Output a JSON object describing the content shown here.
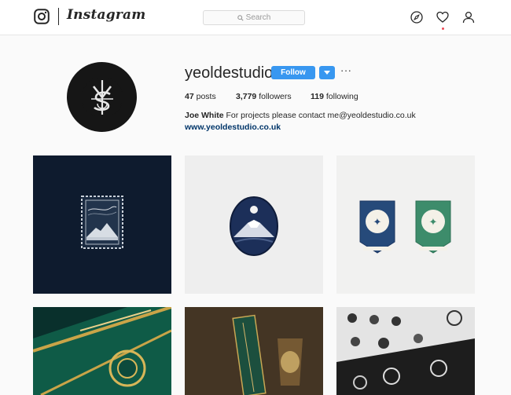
{
  "app": {
    "wordmark": "Instagram"
  },
  "search": {
    "placeholder": "Search"
  },
  "profile": {
    "username": "yeoldestudio",
    "follow_label": "Follow",
    "more_label": "···",
    "stats": {
      "posts_count": "47",
      "posts_label": "posts",
      "followers_count": "3,779",
      "followers_label": "followers",
      "following_count": "119",
      "following_label": "following"
    },
    "bio": {
      "name": "Joe White",
      "text": "For projects please contact me@yeoldestudio.co.uk"
    },
    "website": "www.yeoldestudio.co.uk"
  },
  "colors": {
    "accent": "#3897f0",
    "link": "#003569",
    "notification": "#ed4956"
  },
  "icons": [
    "instagram-logo-icon",
    "search-icon",
    "explore-compass-icon",
    "heart-icon",
    "profile-icon",
    "chevron-down-icon"
  ],
  "posts": [
    {
      "kind": "photo",
      "subject": "stamp"
    },
    {
      "kind": "photo",
      "subject": "mountain-badge"
    },
    {
      "kind": "photo",
      "subject": "labels"
    },
    {
      "kind": "photo",
      "subject": "playing-cards"
    },
    {
      "kind": "photo",
      "subject": "whisky-cards"
    },
    {
      "kind": "photo",
      "subject": "logo-sheet"
    }
  ]
}
